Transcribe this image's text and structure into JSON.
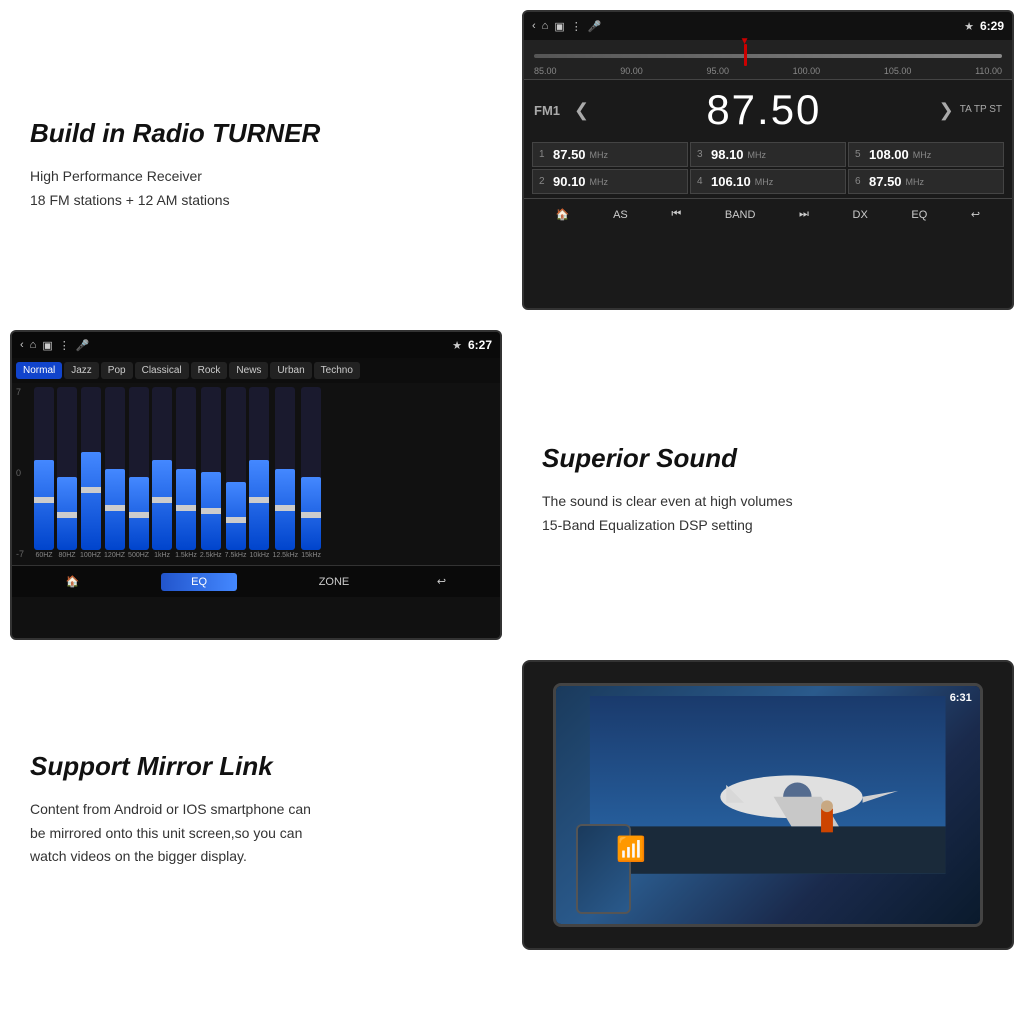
{
  "radio_section": {
    "title": "Build in Radio TURNER",
    "desc_line1": "High Performance Receiver",
    "desc_line2": "18 FM stations + 12 AM stations",
    "screen": {
      "time": "6:29",
      "band": "FM1",
      "frequency": "87.50",
      "ta_tp_st": "TA TP ST",
      "tuner_marks": [
        "85.00",
        "90.00",
        "95.00",
        "100.00",
        "105.00",
        "110.00"
      ],
      "presets": [
        {
          "num": "1",
          "freq": "87.50",
          "unit": "MHz"
        },
        {
          "num": "3",
          "freq": "98.10",
          "unit": "MHz"
        },
        {
          "num": "5",
          "freq": "108.00",
          "unit": "MHz"
        },
        {
          "num": "2",
          "freq": "90.10",
          "unit": "MHz"
        },
        {
          "num": "4",
          "freq": "106.10",
          "unit": "MHz"
        },
        {
          "num": "6",
          "freq": "87.50",
          "unit": "MHz"
        }
      ],
      "bottom_buttons": [
        "🏠",
        "AS",
        "⏮",
        "BAND",
        "⏭",
        "DX",
        "EQ",
        "↩"
      ]
    }
  },
  "eq_section": {
    "screen": {
      "time": "6:27",
      "presets": [
        "Normal",
        "Jazz",
        "Pop",
        "Classical",
        "Rock",
        "News",
        "Urban",
        "Techno"
      ],
      "active_preset": "Normal",
      "bands": [
        {
          "label": "60HZ",
          "fill_pct": 55,
          "handle_pct": 55
        },
        {
          "label": "80HZ",
          "fill_pct": 45,
          "handle_pct": 45
        },
        {
          "label": "100HZ",
          "fill_pct": 60,
          "handle_pct": 60
        },
        {
          "label": "120HZ",
          "fill_pct": 50,
          "handle_pct": 50
        },
        {
          "label": "500HZ",
          "fill_pct": 45,
          "handle_pct": 45
        },
        {
          "label": "1kHz",
          "fill_pct": 55,
          "handle_pct": 55
        },
        {
          "label": "1.5kHz",
          "fill_pct": 50,
          "handle_pct": 50
        },
        {
          "label": "2.5kHz",
          "fill_pct": 48,
          "handle_pct": 48
        },
        {
          "label": "7.5kHz",
          "fill_pct": 42,
          "handle_pct": 42
        },
        {
          "label": "10kHz",
          "fill_pct": 55,
          "handle_pct": 55
        },
        {
          "label": "12.5kHz",
          "fill_pct": 50,
          "handle_pct": 50
        },
        {
          "label": "15kHz",
          "fill_pct": 45,
          "handle_pct": 45
        }
      ],
      "level_labels": [
        "7",
        "0",
        "-7"
      ],
      "bottom_buttons": [
        "🏠",
        "EQ",
        "ZONE",
        "↩"
      ]
    }
  },
  "sound_section": {
    "title": "Superior Sound",
    "desc_line1": "The sound is clear even at high volumes",
    "desc_line2": "15-Band Equalization DSP setting"
  },
  "mirror_section": {
    "title": "Support Mirror Link",
    "desc_line1": "Content from Android or IOS smartphone can",
    "desc_line2": "be mirrored onto this unit screen,so you can",
    "desc_line3": "watch videos on the  bigger display.",
    "screen": {
      "time": "6:31"
    }
  }
}
